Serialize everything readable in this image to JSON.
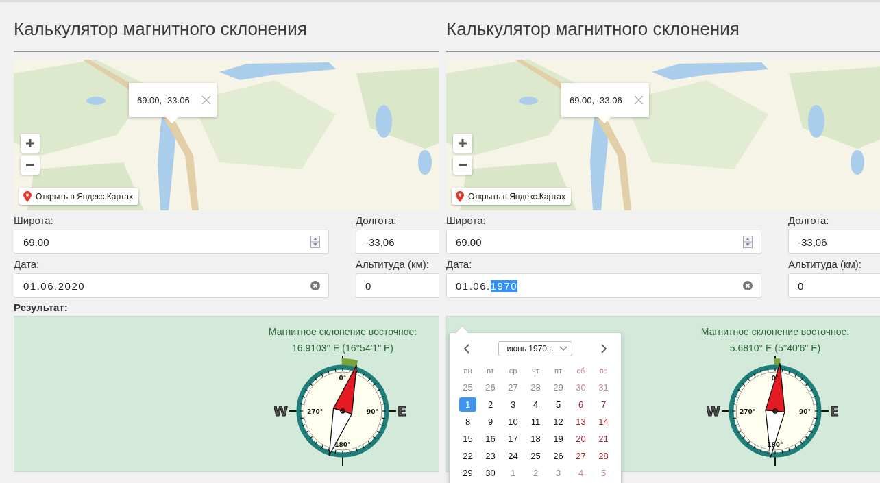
{
  "panels": [
    {
      "title": "Калькулятор магнитного склонения",
      "map": {
        "kind": "picture",
        "popup": "69.00, -33.06",
        "open_link": "Открыть в Яндекс.Картах"
      },
      "fields": [
        {
          "label": "Широта:",
          "value": "69.00",
          "kind": "spinner"
        },
        {
          "label": "Долгота:",
          "value": "-33,06",
          "kind": "plain"
        },
        {
          "label": "Дата:",
          "value": "01.06.2020",
          "kind": "date"
        },
        {
          "label": "Альтитуда (км):",
          "value": "0",
          "kind": "plain"
        }
      ],
      "result_label": "Результат:",
      "result": {
        "heading": "Магнитное склонение восточное:",
        "value": "16.9103° E (16°54'1\" E)",
        "compass": {
          "north": "0°",
          "east": "90°",
          "south": "180°",
          "west": "270°",
          "west_letter": "W",
          "east_letter": "E"
        }
      }
    },
    {
      "title": "Калькулятор магнитного склонения",
      "map": {
        "kind": "picture",
        "popup": "69.00, -33.06",
        "open_link": "Открыть в Яндекс.Картах"
      },
      "fields": [
        {
          "label": "Широта:",
          "value": "69.00",
          "kind": "spinner"
        },
        {
          "label": "Долгота:",
          "value": "-33,06",
          "kind": "plain"
        },
        {
          "label": "Дата:",
          "value": "01.06.",
          "selected_text": "1970",
          "kind": "date"
        },
        {
          "label": "Альтитуда (км):",
          "value": "0",
          "kind": "plain"
        }
      ],
      "date_picker": {
        "month": "июнь 1970 г.",
        "weekdays": [
          {
            "text": "пн",
            "weekend": false
          },
          {
            "text": "вт",
            "weekend": false
          },
          {
            "text": "ср",
            "weekend": false
          },
          {
            "text": "чт",
            "weekend": false
          },
          {
            "text": "пт",
            "weekend": false
          },
          {
            "text": "сб",
            "weekend": true
          },
          {
            "text": "вс",
            "weekend": true
          }
        ],
        "days": [
          {
            "text": "25",
            "kind": "other",
            "weekend": false,
            "selected": false
          },
          {
            "text": "26",
            "kind": "other",
            "weekend": false,
            "selected": false
          },
          {
            "text": "27",
            "kind": "other",
            "weekend": false,
            "selected": false
          },
          {
            "text": "28",
            "kind": "other",
            "weekend": false,
            "selected": false
          },
          {
            "text": "29",
            "kind": "other",
            "weekend": false,
            "selected": false
          },
          {
            "text": "30",
            "kind": "other",
            "weekend": true,
            "selected": false
          },
          {
            "text": "31",
            "kind": "other",
            "weekend": true,
            "selected": false
          },
          {
            "text": "1",
            "kind": "day",
            "weekend": false,
            "selected": true
          },
          {
            "text": "2",
            "kind": "day",
            "weekend": false,
            "selected": false
          },
          {
            "text": "3",
            "kind": "day",
            "weekend": false,
            "selected": false
          },
          {
            "text": "4",
            "kind": "day",
            "weekend": false,
            "selected": false
          },
          {
            "text": "5",
            "kind": "day",
            "weekend": false,
            "selected": false
          },
          {
            "text": "6",
            "kind": "day",
            "weekend": true,
            "selected": false
          },
          {
            "text": "7",
            "kind": "day",
            "weekend": true,
            "selected": false
          },
          {
            "text": "8",
            "kind": "day",
            "weekend": false,
            "selected": false
          },
          {
            "text": "9",
            "kind": "day",
            "weekend": false,
            "selected": false
          },
          {
            "text": "10",
            "kind": "day",
            "weekend": false,
            "selected": false
          },
          {
            "text": "11",
            "kind": "day",
            "weekend": false,
            "selected": false
          },
          {
            "text": "12",
            "kind": "day",
            "weekend": false,
            "selected": false
          },
          {
            "text": "13",
            "kind": "day",
            "weekend": true,
            "selected": false
          },
          {
            "text": "14",
            "kind": "day",
            "weekend": true,
            "selected": false
          },
          {
            "text": "15",
            "kind": "day",
            "weekend": false,
            "selected": false
          },
          {
            "text": "16",
            "kind": "day",
            "weekend": false,
            "selected": false
          },
          {
            "text": "17",
            "kind": "day",
            "weekend": false,
            "selected": false
          },
          {
            "text": "18",
            "kind": "day",
            "weekend": false,
            "selected": false
          },
          {
            "text": "19",
            "kind": "day",
            "weekend": false,
            "selected": false
          },
          {
            "text": "20",
            "kind": "day",
            "weekend": true,
            "selected": false
          },
          {
            "text": "21",
            "kind": "day",
            "weekend": true,
            "selected": false
          },
          {
            "text": "22",
            "kind": "day",
            "weekend": false,
            "selected": false
          },
          {
            "text": "23",
            "kind": "day",
            "weekend": false,
            "selected": false
          },
          {
            "text": "24",
            "kind": "day",
            "weekend": false,
            "selected": false
          },
          {
            "text": "25",
            "kind": "day",
            "weekend": false,
            "selected": false
          },
          {
            "text": "26",
            "kind": "day",
            "weekend": false,
            "selected": false
          },
          {
            "text": "27",
            "kind": "day",
            "weekend": true,
            "selected": false
          },
          {
            "text": "28",
            "kind": "day",
            "weekend": true,
            "selected": false
          },
          {
            "text": "29",
            "kind": "day",
            "weekend": false,
            "selected": false
          },
          {
            "text": "30",
            "kind": "day",
            "weekend": false,
            "selected": false
          },
          {
            "text": "1",
            "kind": "other",
            "weekend": false,
            "selected": false
          },
          {
            "text": "2",
            "kind": "other",
            "weekend": false,
            "selected": false
          },
          {
            "text": "3",
            "kind": "other",
            "weekend": false,
            "selected": false
          },
          {
            "text": "4",
            "kind": "other",
            "weekend": true,
            "selected": false
          },
          {
            "text": "5",
            "kind": "other",
            "weekend": true,
            "selected": false
          }
        ]
      },
      "result": {
        "heading": "Магнитное склонение восточное:",
        "value": "5.6810° E (5°40'6\" E)",
        "compass": {
          "north": "0°",
          "east": "90°",
          "south": "180°",
          "west": "270°",
          "west_letter": "W",
          "east_letter": "E"
        }
      }
    }
  ]
}
